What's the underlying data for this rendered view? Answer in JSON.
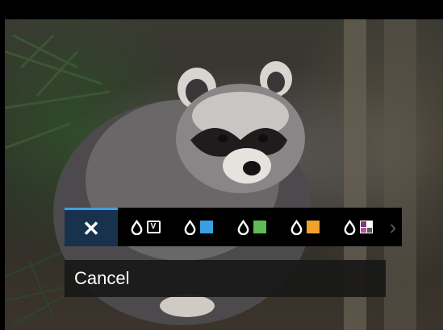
{
  "menu": {
    "cancel_label": "Cancel",
    "items": [
      {
        "name": "cancel",
        "icon": "close-icon"
      },
      {
        "name": "vivid",
        "icon": "drop-v-icon",
        "text": "V"
      },
      {
        "name": "blue",
        "icon": "drop-blue-icon",
        "color": "#3a9fe0"
      },
      {
        "name": "green",
        "icon": "drop-green-icon",
        "color": "#5fbb55"
      },
      {
        "name": "orange",
        "icon": "drop-orange-icon",
        "color": "#f2a12b"
      },
      {
        "name": "mixed",
        "icon": "drop-grid-icon",
        "colors": [
          "#7b3d7a",
          "#ffffff",
          "#b94ea0",
          "#5a5a5a"
        ]
      }
    ],
    "selected_index": 0,
    "accent_color": "#3f9fe0"
  }
}
